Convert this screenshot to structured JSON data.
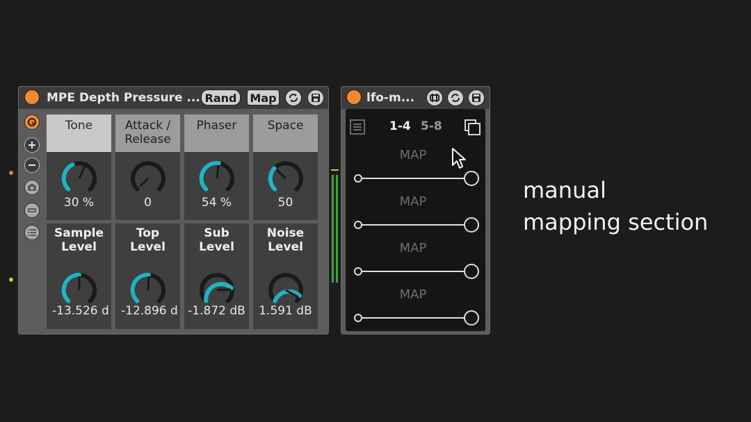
{
  "device1": {
    "title": "MPE Depth Pressure ...",
    "rand_label": "Rand",
    "map_label": "Map",
    "knobs": [
      {
        "label": "Tone",
        "value": "30 %"
      },
      {
        "label": "Attack / Release",
        "value": "0"
      },
      {
        "label": "Phaser",
        "value": "54 %"
      },
      {
        "label": "Space",
        "value": "50"
      },
      {
        "label": "Sample Level",
        "value": "-13.526 d"
      },
      {
        "label": "Top Level",
        "value": "-12.896 d"
      },
      {
        "label": "Sub Level",
        "value": "-1.872 dB"
      },
      {
        "label": "Noise Level",
        "value": "1.591 dB"
      }
    ]
  },
  "device2": {
    "title": "lfo-m...",
    "page_tabs": [
      "1-4",
      "5-8"
    ],
    "active_page": "1-4",
    "map_slots": [
      "MAP",
      "MAP",
      "MAP",
      "MAP"
    ]
  },
  "caption": {
    "line1": "manual",
    "line2": "mapping section"
  },
  "colors": {
    "background": "#1c1c1c",
    "power_orange": "#f08b2f",
    "knob_accent": "#1fb3c4",
    "meter_green": "#3aa640"
  },
  "icons": [
    "power-icon",
    "reload-icon",
    "save-icon",
    "plus-icon",
    "minus-icon",
    "camera-icon",
    "bar-icon",
    "list-icon",
    "copy-icon",
    "mouse-cursor-icon"
  ]
}
